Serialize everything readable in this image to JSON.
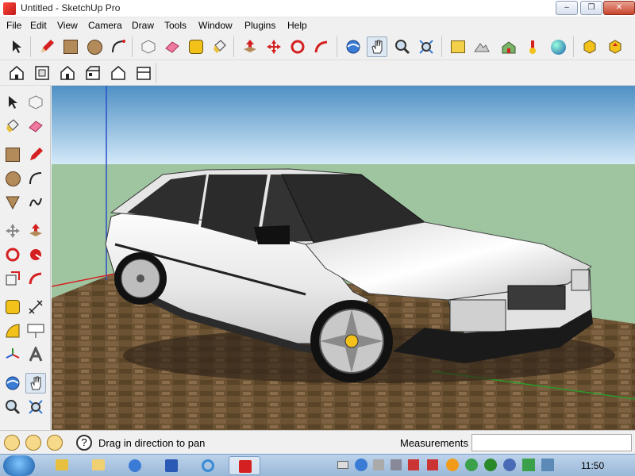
{
  "window": {
    "title": "Untitled - SketchUp Pro",
    "min_label": "–",
    "max_label": "❐",
    "close_label": "✕"
  },
  "menu": [
    "File",
    "Edit",
    "View",
    "Camera",
    "Draw",
    "Tools",
    "Window",
    "Plugins",
    "Help"
  ],
  "status": {
    "hint": "Drag in direction to pan",
    "measurements_label": "Measurements",
    "measurements_value": ""
  },
  "taskbar": {
    "clock": "11:50"
  },
  "colors": {
    "sky_top": "#4f90c4",
    "sky_bottom": "#cfe6f7",
    "ground": "#9fc4a0",
    "floor": "#6b5233",
    "accent_red": "#d42020"
  },
  "toolbar_top": [
    "select-icon",
    "pencil-icon",
    "rectangle-icon",
    "circle-icon",
    "arc-icon",
    "make-component-icon",
    "eraser-icon",
    "tape-measure-icon",
    "paint-bucket-icon",
    "push-pull-icon",
    "move-icon",
    "rotate-icon",
    "follow-me-icon",
    "orbit-icon",
    "pan-icon",
    "zoom-icon",
    "zoom-extents-icon",
    "add-location-icon",
    "toggle-terrain-icon",
    "get-models-icon",
    "share-model-icon",
    "google-earth-icon",
    "get-components-icon",
    "share-component-icon"
  ],
  "toolbar_views": [
    "iso-view-icon",
    "top-view-icon",
    "front-view-icon",
    "right-view-icon",
    "back-view-icon",
    "left-view-icon"
  ],
  "left_tools": [
    "select-icon",
    "make-component-icon",
    "paint-bucket-icon",
    "eraser-icon",
    "rectangle-icon",
    "pencil-icon",
    "circle-icon",
    "arc-icon",
    "polygon-icon",
    "freehand-icon",
    "move-icon",
    "push-pull-icon",
    "rotate-icon",
    "follow-me-icon",
    "scale-icon",
    "offset-icon",
    "tape-measure-icon",
    "dimension-icon",
    "protractor-icon",
    "text-icon",
    "axes-icon",
    "3d-text-icon",
    "orbit-icon",
    "pan-icon",
    "zoom-icon",
    "zoom-window-icon"
  ]
}
